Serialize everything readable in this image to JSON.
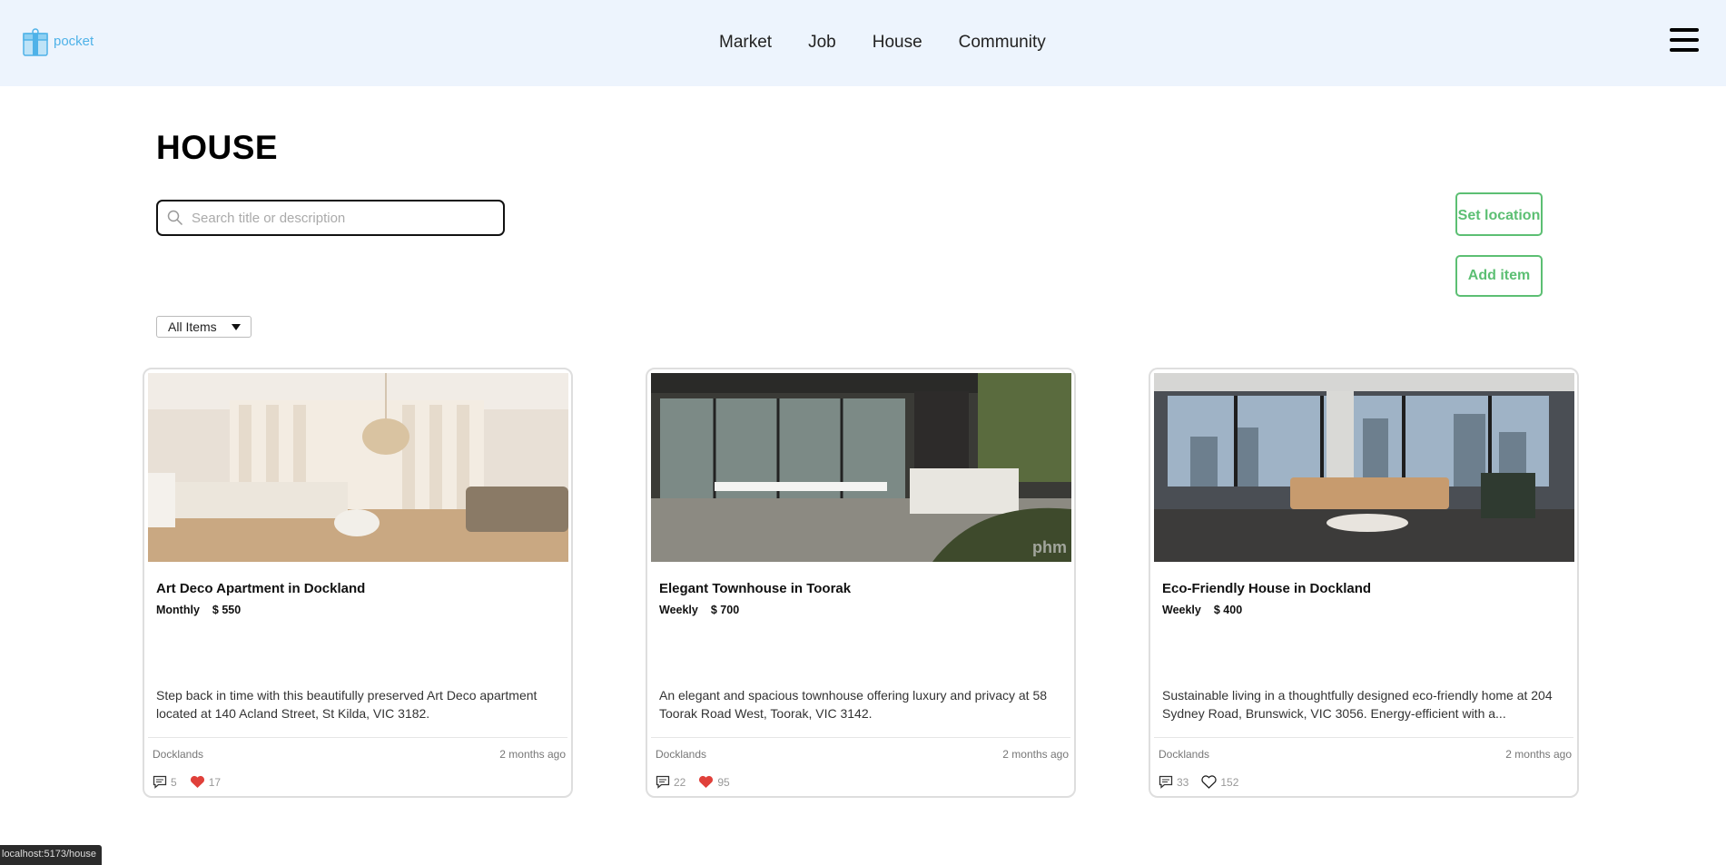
{
  "header": {
    "logo_text": "pocket",
    "nav": [
      "Market",
      "Job",
      "House",
      "Community"
    ]
  },
  "page_title": "HOUSE",
  "search": {
    "placeholder": "Search title or description"
  },
  "buttons": {
    "set_location": "Set location",
    "add_item": "Add item"
  },
  "filter": {
    "selected": "All Items"
  },
  "cards": [
    {
      "title": "Art Deco Apartment in Dockland",
      "period": "Monthly",
      "price": "$ 550",
      "description": "Step back in time with this beautifully preserved Art Deco apartment located at 140 Acland Street, St Kilda, VIC 3182.",
      "location": "Docklands",
      "time": "2 months ago",
      "comments": "5",
      "likes": "17",
      "liked": true
    },
    {
      "title": "Elegant Townhouse in Toorak",
      "period": "Weekly",
      "price": "$ 700",
      "description": "An elegant and spacious townhouse offering luxury and privacy at 58 Toorak Road West, Toorak, VIC 3142.",
      "location": "Docklands",
      "time": "2 months ago",
      "comments": "22",
      "likes": "95",
      "liked": true
    },
    {
      "title": "Eco-Friendly House in Dockland",
      "period": "Weekly",
      "price": "$ 400",
      "description": "Sustainable living in a thoughtfully designed eco-friendly home at 204 Sydney Road, Brunswick, VIC 3056. Energy-efficient with a...",
      "location": "Docklands",
      "time": "2 months ago",
      "comments": "33",
      "likes": "152",
      "liked": false
    }
  ],
  "statusbar": {
    "url": "localhost:5173/house"
  },
  "colors": {
    "header_bg": "#edf4fd",
    "accent_green": "#5cbf73",
    "logo_blue": "#4fb2e8",
    "heart_red": "#e0403a"
  }
}
